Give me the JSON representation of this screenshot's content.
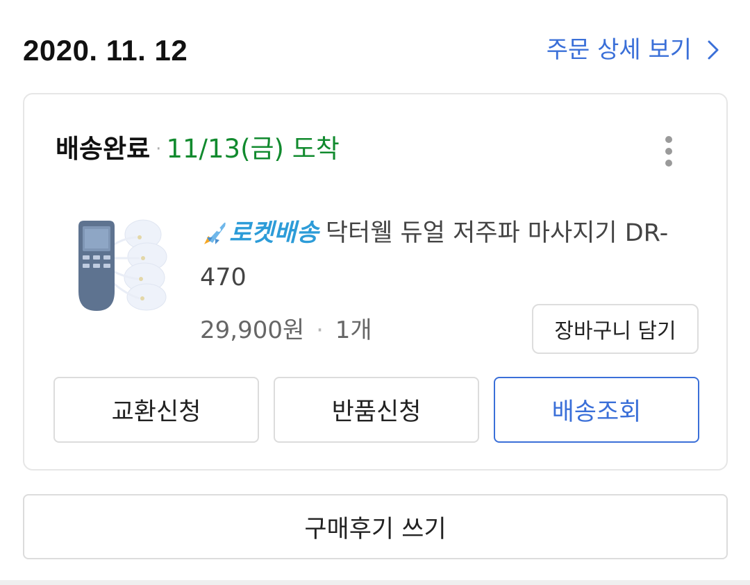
{
  "order": {
    "date": "2020. 11. 12",
    "detail_link_label": "주문 상세 보기"
  },
  "shipment": {
    "status": "배송완료",
    "separator": "·",
    "arrival": "11/13(금) 도착"
  },
  "product": {
    "badge_label": "로켓배송",
    "name": "닥터웰 듀얼 저주파 마사지기 DR-470",
    "price": "29,900원",
    "separator": "·",
    "quantity": "1개",
    "cart_button_label": "장바구니 담기"
  },
  "actions": {
    "exchange_label": "교환신청",
    "return_label": "반품신청",
    "tracking_label": "배송조회"
  },
  "review": {
    "button_label": "구매후기 쓰기"
  },
  "icons": {
    "detail_link": "chevron-right-icon",
    "more": "more-vertical-icon",
    "badge": "rocket-icon",
    "product": "massager-product-image"
  },
  "colors": {
    "link_blue": "#3a6fd8",
    "arrival_green": "#118a2e",
    "rocket_blue": "#2d9cd8",
    "border_gray": "#dcdcdc"
  }
}
